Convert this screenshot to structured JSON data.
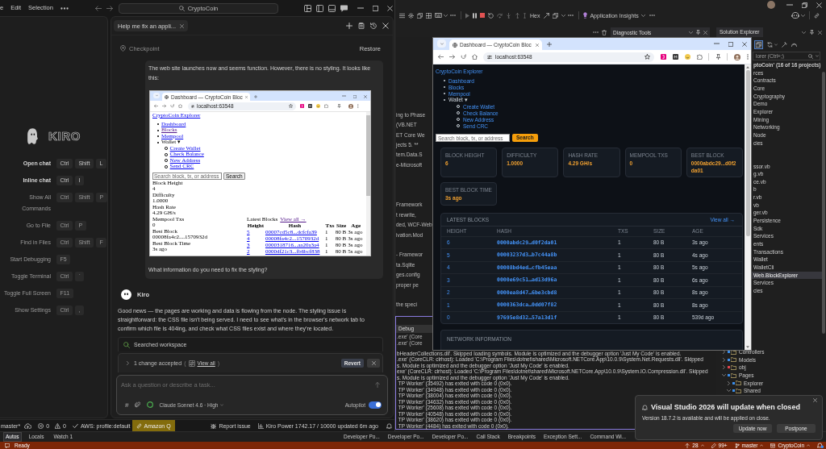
{
  "kiro": {
    "menu": [
      "e",
      "Edit",
      "Selection"
    ],
    "search": "CryptoCoin",
    "welcome": {
      "logo": "KIRO",
      "shortcuts": [
        {
          "label": "Open chat",
          "primary": true,
          "keys": [
            "Ctrl",
            "Shift",
            "L"
          ]
        },
        {
          "label": "Inline chat",
          "primary": true,
          "keys": [
            "Ctrl",
            "I"
          ]
        },
        {
          "label": "Show All Commands",
          "primary": false,
          "keys": [
            "Ctrl",
            "Shift",
            "P"
          ]
        },
        {
          "label": "Go to File",
          "primary": false,
          "keys": [
            "Ctrl",
            "P"
          ]
        },
        {
          "label": "Find in Files",
          "primary": false,
          "keys": [
            "Ctrl",
            "Shift",
            "F"
          ]
        },
        {
          "label": "Start Debugging",
          "primary": false,
          "keys": [
            "F5"
          ]
        },
        {
          "label": "Toggle Terminal",
          "primary": false,
          "keys": [
            "Ctrl",
            "`"
          ]
        },
        {
          "label": "Toggle Full Screen",
          "primary": false,
          "keys": [
            "F11"
          ]
        },
        {
          "label": "Show Settings",
          "primary": false,
          "keys": [
            "Ctrl",
            ","
          ]
        }
      ]
    },
    "chat": {
      "tab": "Help me fix an appli...",
      "checkpoint": "Checkpoint",
      "restore": "Restore",
      "user_message": {
        "text": "The web site launches now and seems function. However, there is no styling. It looks like this:",
        "screenshot": {
          "tab_title": "Dashboard — CryptoCoin Bloc",
          "url": "localhost:63548",
          "brand": "CryptoCoin Explorer",
          "nav": [
            {
              "label": "Dashboard",
              "visited": false
            },
            {
              "label": "Blocks",
              "visited": true
            },
            {
              "label": "Mempool",
              "visited": false
            },
            {
              "label": "Wallet ▾",
              "children": [
                {
                  "label": "Create Wallet",
                  "visited": false
                },
                {
                  "label": "Check Balance",
                  "visited": false
                },
                {
                  "label": "New Address",
                  "visited": false
                },
                {
                  "label": "Send CRC",
                  "visited": false
                }
              ]
            }
          ],
          "search_placeholder": "Search block, tx, or address",
          "search_button": "Search",
          "stats": [
            {
              "label": "Block Height",
              "value": "4"
            },
            {
              "label": "Difficulty",
              "value": "1.0000"
            },
            {
              "label": "Hash Rate",
              "value": "4.29 GH/s"
            },
            {
              "label": "Mempool Txs",
              "value": "0"
            },
            {
              "label": "Best Block",
              "value": "00008fa4c2....1570932d"
            },
            {
              "label": "Best Block Time",
              "value": "3s ago"
            }
          ],
          "latest": "Latest Blocks",
          "view_all": {
            "label": "View all →",
            "visited": true
          },
          "columns": [
            "Height",
            "Hash",
            "Txs",
            "Size",
            "Age"
          ],
          "rows": [
            [
              "5",
              "00007cd5c8...dcfcfa39",
              "1",
              "80 B",
              "3s ago"
            ],
            [
              "4",
              "00008fa4c2...1570932d",
              "1",
              "80 B",
              "3s ago"
            ],
            [
              "3",
              "0000318716...aa20a3a4",
              "1",
              "80 B",
              "3s ago"
            ],
            [
              "2",
              "0000df21c3...fb6bcf838",
              "1",
              "80 B",
              "5s ago"
            ]
          ]
        },
        "question": "What information do you need to fix the styling?"
      },
      "assistant": {
        "name": "Kiro",
        "text": "Good news — the pages are working and data is flowing from the node. The styling issue is straightforward: the CSS file isn't being served. I need to see what's in the browser's network tab to confirm which file is 404ing, and check what CSS files exist and where they're located."
      },
      "tool_call": "Searched workspace",
      "changes": {
        "summary": "1 change accepted",
        "open_paren": "(",
        "link": "View all",
        "close_paren": ")",
        "revert": "Revert"
      },
      "composer": {
        "placeholder": "Ask a question or describe a task...",
        "context": "#",
        "model": "Claude Sonnet 4.6 · High",
        "autopilot": {
          "label": "Autopilot",
          "on": true
        }
      }
    },
    "status_bar": {
      "branch": "master*",
      "errors": "0",
      "warnings": "0",
      "aws": "AWS: profile:default",
      "amazon_q": "Amazon Q",
      "report": "Report issue",
      "usage": "Kiro Power 1742.17 / 10000 updated 6m ago"
    }
  },
  "visual_studio": {
    "toolbar": {
      "hex": "Hex",
      "insights": "Application Insights"
    },
    "diagnostics_tab": "Diagnostic Tools",
    "editor_fragments": [
      [
        "ing to Phase",
        "(VB.NET",
        "ET Core We",
        "jects 5. **",
        "tem.Data.S",
        "e-Microsoft"
      ],
      [
        "Framework",
        "t rewrite,",
        "ded, WCF-Web",
        "ivation.Mod"
      ],
      [
        "- Framewor",
        "ta.Sqlite",
        "ges.config",
        "proper pe"
      ],
      [
        "the speci"
      ]
    ],
    "output": {
      "source": "Debug",
      "fragments": [
        ".exe' (Core",
        ".exe' (Core"
      ],
      "lines": [
        "bHeaderCollections.dll'. Skipped loading symbols. Module is optimized and the debugger option 'Just My Code' is enabled.",
        ".exe' (CoreCLR: clrhost): Loaded 'C:\\Program Files\\dotnet\\shared\\Microsoft.NETCore.App\\10.0.9\\System.Net.Requests.dll'. Skipped",
        "s. Module is optimized and the debugger option 'Just My Code' is enabled.",
        "exe' (CoreCLR: clrhost): Loaded 'C:\\Program Files\\dotnet\\shared\\Microsoft.NETCore.App\\10.0.9\\System.IO.Compression.dll'. Skipped",
        "s. Module is optimized and the debugger option 'Just My Code' is enabled.",
        " TP Worker' (35492) has exited with code 0 (0x0).",
        " TP Worker' (34948) has exited with code 0 (0x0).",
        " TP Worker' (38004) has exited with code 0 (0x0).",
        " TP Worker' (34632) has exited with code 0 (0x0).",
        " TP Worker' (25608) has exited with code 0 (0x0).",
        " TP Worker' (40548) has exited with code 0 (0x0).",
        " TP Worker' (38620) has exited with code 0 (0x0).",
        " TP Worker' (4484) has exited with code 0 (0x0)."
      ]
    },
    "solution_explorer": {
      "title": "Solution Explorer",
      "placeholder": "lorer (Ctrl+;)",
      "solution": "ptoCoin' (16 of 16 projects)",
      "groups": [
        [
          {
            "label": "rces",
            "selected": false
          },
          {
            "label": "Contracts",
            "selected": false
          },
          {
            "label": "Core",
            "selected": false
          },
          {
            "label": "Cryptography",
            "selected": false
          },
          {
            "label": "Demo",
            "selected": false
          },
          {
            "label": "Explorer",
            "selected": false
          },
          {
            "label": "Mining",
            "selected": false
          },
          {
            "label": "Networking",
            "selected": false
          },
          {
            "label": "Node",
            "selected": false
          },
          {
            "label": "cies",
            "selected": false
          }
        ],
        [
          {
            "label": "ssor.vb",
            "selected": false
          },
          {
            "label": "g.vb",
            "selected": false
          },
          {
            "label": "ce.vb",
            "selected": false
          },
          {
            "label": "b",
            "selected": false
          },
          {
            "label": "r.vb",
            "selected": false
          },
          {
            "label": "vb",
            "selected": false
          },
          {
            "label": "ger.vb",
            "selected": false
          },
          {
            "label": "Persistence",
            "selected": false
          },
          {
            "label": "Sdk",
            "selected": false
          },
          {
            "label": "Services",
            "selected": false
          },
          {
            "label": "ents",
            "selected": false
          },
          {
            "label": "Transactions",
            "selected": false
          },
          {
            "label": "Wallet",
            "selected": false
          },
          {
            "label": "WalletCli",
            "selected": false
          },
          {
            "label": "Web.BlockExplorer",
            "selected": true
          },
          {
            "label": "Services",
            "selected": false
          },
          {
            "label": "cies",
            "selected": false
          }
        ]
      ],
      "tree": [
        {
          "label": "Controllers",
          "expanded": false,
          "color": "#3b8eea"
        },
        {
          "label": "Models",
          "expanded": false,
          "color": "#3b8eea"
        },
        {
          "label": "obj",
          "expanded": false,
          "color": "#e0454f"
        },
        {
          "label": "Pages",
          "expanded": true,
          "color": "#3b8eea",
          "children": [
            {
              "label": "Explorer",
              "expanded": false,
              "color": "#3b8eea"
            },
            {
              "label": "Shared",
              "expanded": true,
              "color": "#3b8eea"
            }
          ]
        }
      ]
    },
    "debug_tabs": [
      {
        "label": "Autos",
        "selected": true
      },
      {
        "label": "Locals",
        "selected": false
      },
      {
        "label": "Watch 1",
        "selected": false
      }
    ],
    "tool_tabs": [
      {
        "label": "Developer Po...",
        "selected": false
      },
      {
        "label": "Developer Po...",
        "selected": false
      },
      {
        "label": "Developer Po...",
        "selected": false
      },
      {
        "label": "Call Stack",
        "selected": false
      },
      {
        "label": "Breakpoints",
        "selected": false
      },
      {
        "label": "Exception Sett...",
        "selected": false
      },
      {
        "label": "Command Wi...",
        "selected": false
      }
    ],
    "status_bar": {
      "state": "Ready",
      "outgoing": "28",
      "changes": "99+",
      "branch": "master",
      "repo": "CryptoCoin"
    }
  },
  "browser": {
    "tab_title": "Dashboard — CryptoCoin Bloc",
    "url": "localhost:63548",
    "brand": "CryptoCoin Explorer",
    "nav": [
      {
        "label": "Dashboard"
      },
      {
        "label": "Blocks"
      },
      {
        "label": "Mempool"
      },
      {
        "label": "Wallet ▾",
        "children": [
          {
            "label": "Create Wallet"
          },
          {
            "label": "Check Balance"
          },
          {
            "label": "New Address"
          },
          {
            "label": "Send CRC"
          }
        ]
      }
    ],
    "search": {
      "placeholder": "Search block, tx, or address",
      "button": "Search"
    },
    "stats": [
      {
        "label": "BLOCK HEIGHT",
        "value": "6"
      },
      {
        "label": "DIFFICULTY",
        "value": "1.0000"
      },
      {
        "label": "HASH RATE",
        "value": "4.29 GH/s"
      },
      {
        "label": "MEMPOOL TXS",
        "value": "0"
      },
      {
        "label": "BEST BLOCK",
        "value": "0000abdc29...d0f2da01"
      },
      {
        "label": "BEST BLOCK TIME",
        "value": "3s ago"
      }
    ],
    "latest_blocks": {
      "title": "LATEST BLOCKS",
      "link": "View all →",
      "columns": [
        "HEIGHT",
        "HASH",
        "TXS",
        "SIZE",
        "AGE"
      ],
      "rows": [
        [
          "6",
          "0000abdc29…d0f2da01",
          "1",
          "80 B",
          "3s ago"
        ],
        [
          "5",
          "00003237d3…b7c44a8b",
          "1",
          "80 B",
          "4s ago"
        ],
        [
          "4",
          "00008bd4ed…cfb45eaa",
          "1",
          "80 B",
          "5s ago"
        ],
        [
          "3",
          "0000e69c51…ad13d96a",
          "1",
          "80 B",
          "6s ago"
        ],
        [
          "2",
          "0000ea8d47…6be3cbd8",
          "1",
          "80 B",
          "8s ago"
        ],
        [
          "1",
          "0000363dca…0dd07f82",
          "1",
          "80 B",
          "8s ago"
        ],
        [
          "0",
          "97695e8d32…57a13d1f",
          "1",
          "80 B",
          "539d ago"
        ]
      ]
    },
    "network_title": "NETWORK INFORMATION"
  },
  "notification": {
    "title": "Visual Studio 2026 will update when closed",
    "body": "Version 18.7.2 is available and will be applied on close.",
    "buttons": [
      "Update now",
      "Postpone"
    ]
  }
}
